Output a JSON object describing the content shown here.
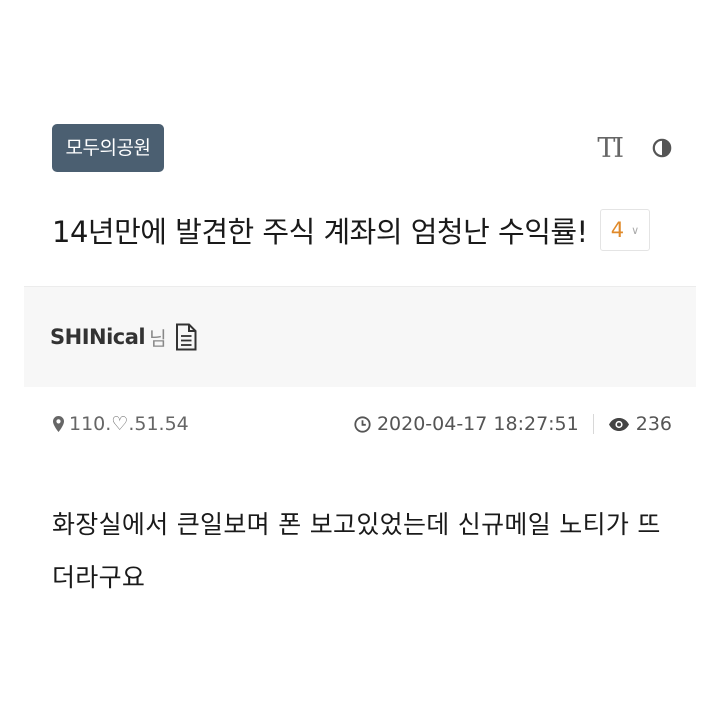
{
  "category": {
    "label": "모두의공원"
  },
  "tools": {
    "font_size_label": "TI"
  },
  "post": {
    "title": "14년만에 발견한 주식 계좌의 엄청난 수익률!",
    "comment_count": "4"
  },
  "author": {
    "name": "SHINical",
    "suffix": "님"
  },
  "meta": {
    "ip": "110.♡.51.54",
    "datetime": "2020-04-17 18:27:51",
    "views": "236"
  },
  "body": {
    "line1": "화장실에서 큰일보며 폰 보고있었는데 신규메일 노티가 뜨",
    "line2": "더라구요"
  },
  "colors": {
    "badge_bg": "#4b5f71",
    "comment_count": "#e08a2a",
    "author_bar_bg": "#f7f7f7"
  },
  "icons": [
    "font-size-icon",
    "contrast-icon",
    "chevron-down-icon",
    "document-icon",
    "location-pin-icon",
    "clock-icon",
    "eye-icon"
  ]
}
